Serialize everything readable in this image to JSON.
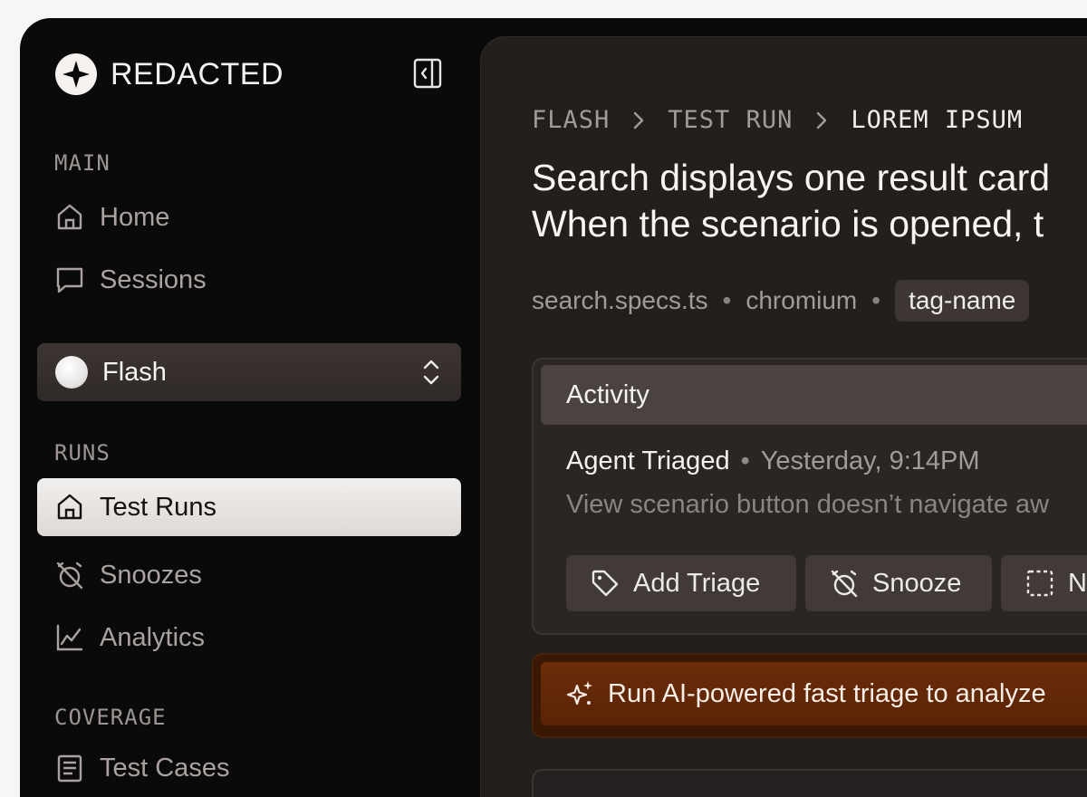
{
  "brand": {
    "name": "REDACTED"
  },
  "sidebar": {
    "sections": {
      "main": "MAIN",
      "runs": "RUNS",
      "coverage": "COVERAGE"
    },
    "main_items": [
      {
        "label": "Home",
        "icon": "home-icon"
      },
      {
        "label": "Sessions",
        "icon": "chat-icon"
      }
    ],
    "project": {
      "name": "Flash"
    },
    "runs_items": [
      {
        "label": "Test Runs",
        "icon": "home-icon",
        "active": true
      },
      {
        "label": "Snoozes",
        "icon": "alarm-off-icon"
      },
      {
        "label": "Analytics",
        "icon": "chart-line-icon"
      }
    ],
    "coverage_items": [
      {
        "label": "Test Cases",
        "icon": "list-icon"
      }
    ]
  },
  "breadcrumb": [
    "FLASH",
    "TEST RUN",
    "LOREM IPSUM"
  ],
  "page": {
    "title_line1": "Search displays one result card",
    "title_line2": "When the scenario is opened, t",
    "meta_file": "search.specs.ts",
    "meta_browser": "chromium",
    "meta_sep": "•",
    "tag": "tag-name"
  },
  "activity": {
    "header": "Activity",
    "event_title": "Agent Triaged",
    "event_sep": "•",
    "event_time": "Yesterday, 9:14PM",
    "event_desc": "View scenario button doesn’t navigate aw",
    "actions": [
      {
        "label": "Add Triage",
        "icon": "tag-icon"
      },
      {
        "label": "Snooze",
        "icon": "alarm-off-icon"
      },
      {
        "label": "N",
        "icon": "dashed-square-icon"
      }
    ]
  },
  "ai_banner": {
    "text": "Run AI-powered fast triage to analyze",
    "icon": "sparkle-icon"
  },
  "colors": {
    "accent_orange": "#6c2c08",
    "sidebar_bg": "#0b0a0a",
    "panel_bg": "#231f1d"
  }
}
